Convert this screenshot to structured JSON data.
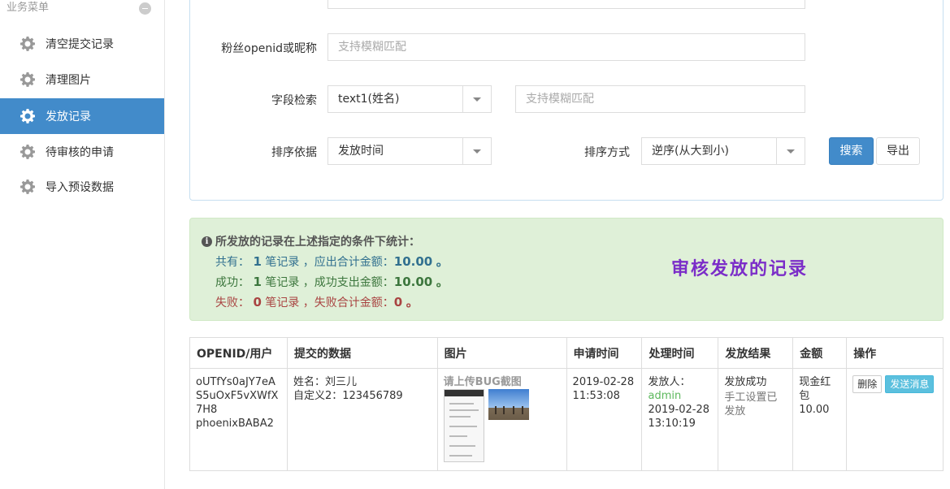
{
  "sidebar": {
    "title": "业务菜单",
    "items": [
      {
        "label": "清空提交记录",
        "icon": "gear-icon",
        "active": false
      },
      {
        "label": "清理图片",
        "icon": "gear-icon",
        "active": false
      },
      {
        "label": "发放记录",
        "icon": "gear-icon",
        "active": true
      },
      {
        "label": "待审核的申请",
        "icon": "gear-icon",
        "active": false
      },
      {
        "label": "导入预设数据",
        "icon": "gear-icon",
        "active": false
      }
    ]
  },
  "search": {
    "fan_label": "粉丝openid或昵称",
    "fan_placeholder": "支持模糊匹配",
    "field_label": "字段检索",
    "field_select": "text1(姓名)",
    "field_placeholder": "支持模糊匹配",
    "sort_by_label": "排序依据",
    "sort_by_value": "发放时间",
    "sort_order_label": "排序方式",
    "sort_order_value": "逆序(从大到小)",
    "search_button": "搜索",
    "export_button": "导出"
  },
  "stats": {
    "title": "所发放的记录在上述指定的条件下统计：",
    "total_prefix": "共有：",
    "total_count": "1",
    "total_mid": "笔记录 ，应出合计金额：",
    "total_amount": "10.00",
    "total_suffix": "。",
    "success_prefix": "成功：",
    "success_count": "1",
    "success_mid": "笔记录 ，成功支出金额：",
    "success_amount": "10.00",
    "success_suffix": "。",
    "fail_prefix": "失败：",
    "fail_count": "0",
    "fail_mid": "笔记录 ，失败合计金额：",
    "fail_amount": "0",
    "fail_suffix": "。",
    "overlay_text": "审核发放的记录"
  },
  "table": {
    "headers": [
      "OPENID/用户",
      "提交的数据",
      "图片",
      "申请时间",
      "处理时间",
      "发放结果",
      "金额",
      "操作"
    ],
    "row": {
      "openid": "oUTfYs0aJY7eAS5uOxF5vXWfX7H8",
      "user": "phoenixBABA2",
      "name_label": "姓名：刘三儿",
      "custom_label": "自定义2：123456789",
      "image_hint": "请上传BUG截图",
      "apply_date": "2019-02-28",
      "apply_time": "11:53:08",
      "issuer_label": "发放人：",
      "issuer": "admin",
      "process_date": "2019-02-28",
      "process_time": "13:10:19",
      "result": "发放成功",
      "result_note": "手工设置已发放",
      "amount_type": "现金红包",
      "amount": "10.00",
      "delete_button": "删除",
      "send_button": "发送消息"
    }
  },
  "colors": {
    "primary": "#428bca",
    "success_bg": "#dff0d8",
    "overlay": "#7b2dc8",
    "info_btn": "#5bc0de"
  }
}
